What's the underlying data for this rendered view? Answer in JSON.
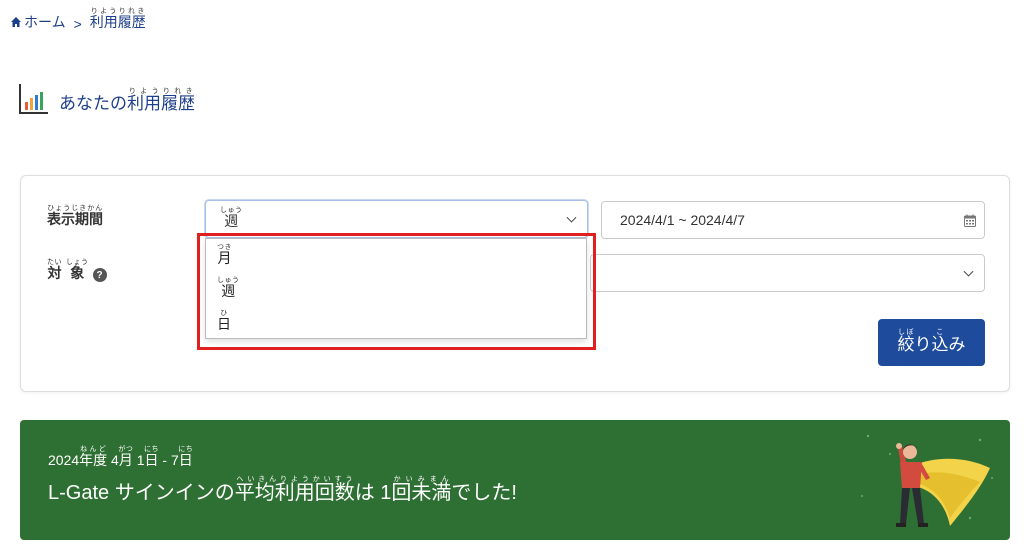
{
  "breadcrumb": {
    "home": "ホーム",
    "separator": ">",
    "current_base": "利用履歴",
    "current_ruby": "りようりれき"
  },
  "page": {
    "title_prefix": "あなたの",
    "title_base": "利用履歴",
    "title_ruby": "りようりれき"
  },
  "filters": {
    "period_label": "表示期間",
    "period_label_ruby": "ひょうじきかん",
    "period_selected": "週",
    "period_selected_ruby": "しゅう",
    "date_range": "2024/4/1 ~ 2024/4/7",
    "target_label_1": "対",
    "target_label_1_ruby": "たい",
    "target_label_2": "象",
    "target_label_2_ruby": "しょう",
    "help_icon": "?",
    "options": [
      {
        "label": "月",
        "ruby": "つき"
      },
      {
        "label": "週",
        "ruby": "しゅう"
      },
      {
        "label": "日",
        "ruby": "ひ"
      }
    ],
    "submit_base": "絞",
    "submit_base_ruby": "しぼ",
    "submit_mid": "り",
    "submit_base2": "込",
    "submit_base2_ruby": "こ",
    "submit_end": "み"
  },
  "banner": {
    "year": "2024",
    "nendo": "年度",
    "nendo_ruby": "ねんど",
    "month": "4",
    "gatsu": "月",
    "gatsu_ruby": "がつ",
    "day_start": "1",
    "nichi": "日",
    "nichi_ruby": "にち",
    "range_sep": " - ",
    "day_end": "7",
    "nichi2": "日",
    "nichi2_ruby": "にち",
    "summary_prefix": "L-Gate サインインの",
    "summary_word": "平均利用回数",
    "summary_word_ruby": "へいきんりようかいすう",
    "summary_mid": "は 1",
    "summary_word2": "回未満",
    "summary_word2_ruby": "かいみまん",
    "summary_end": "でした!"
  },
  "icons": {
    "home": "home-icon",
    "chart": "bar-chart-icon",
    "calendar": "calendar-icon",
    "chevron": "chevron-down-icon",
    "help": "question-circle-icon"
  },
  "colors": {
    "brand_blue": "#1e4b9b",
    "link_blue": "#1e3f8a",
    "banner_green": "#2e7033",
    "highlight_red": "#e02020"
  }
}
